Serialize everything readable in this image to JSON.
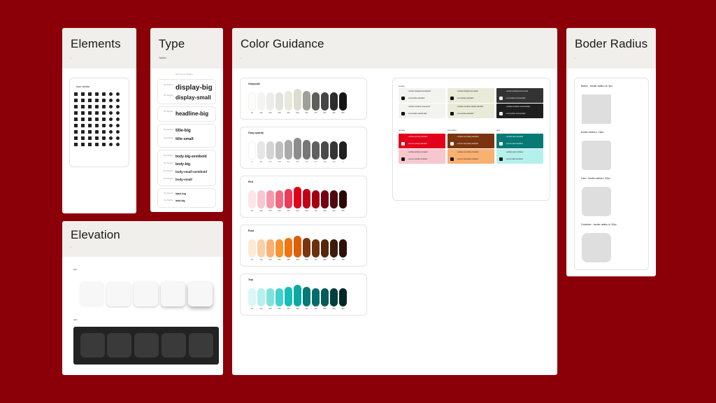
{
  "elements": {
    "title": "Elements",
    "sub": "-",
    "icon_panel_label": "icon stroke"
  },
  "type": {
    "title": "Type",
    "sub": "Tablet",
    "header_note": "Size  Line Ht  Tracking",
    "rows": [
      {
        "meta": "Tiny Medium",
        "text": "display-big"
      },
      {
        "meta": "Tiny Medium",
        "text": "display-small"
      },
      {
        "meta": "Tiny Medium",
        "text": "headline-big"
      },
      {
        "meta": "Tiny Medium",
        "text": "title-big"
      },
      {
        "meta": "Tiny Medium",
        "text": "title-small"
      },
      {
        "meta": "Tiny Medium",
        "text": "body-big-semibold"
      },
      {
        "meta": "Tiny Medium",
        "text": "body-big"
      },
      {
        "meta": "Tiny Medium",
        "text": "body-small-semibold"
      },
      {
        "meta": "Tiny Medium",
        "text": "body-small"
      },
      {
        "meta": "Tiny Medium",
        "text": "label-big"
      },
      {
        "meta": "Tiny Medium",
        "text": "label-big"
      }
    ]
  },
  "color": {
    "title": "Color Guidance",
    "sub": "-",
    "scales": [
      {
        "name": "Grayscale",
        "colors": [
          "#fbfbf8",
          "#f4f4f1",
          "#ececea",
          "#e2e2de",
          "#e8e8dc",
          "#dcdccf",
          "#a0a098",
          "#5e5e5c",
          "#454545",
          "#2d2d2d",
          "#151515"
        ],
        "labels": [
          "50",
          "100",
          "200",
          "300",
          "400",
          "500",
          "600",
          "700",
          "800",
          "900",
          "950"
        ]
      },
      {
        "name": "Gray-opacity",
        "colors": [
          "#ffffff",
          "#e6e6e6",
          "#d4d4d4",
          "#bfbfbf",
          "#aaaaaa",
          "#8c8c8c",
          "#777777",
          "#606060",
          "#4a4a4a",
          "#353535",
          "#202020"
        ],
        "labels": [
          "0",
          "0.1",
          "0.2",
          "0.3",
          "0.4",
          "0.5",
          "0.6",
          "0.7",
          "0.8",
          "0.9",
          "1"
        ]
      },
      {
        "name": "Red",
        "colors": [
          "#fbe6e8",
          "#f7c7cf",
          "#f59aab",
          "#f2667f",
          "#ec3a58",
          "#e3001b",
          "#c10017",
          "#a30014",
          "#760012",
          "#4e0b0d",
          "#2c0607"
        ],
        "labels": [
          "50",
          "100",
          "200",
          "300",
          "400",
          "500",
          "600",
          "700",
          "800",
          "900",
          "950"
        ]
      },
      {
        "name": "Rust",
        "colors": [
          "#fde9d6",
          "#fbd0a8",
          "#f9b070",
          "#f7932f",
          "#f07410",
          "#dd5f07",
          "#7a3510",
          "#6b300f",
          "#57270c",
          "#3c1c0c",
          "#2a1208"
        ],
        "labels": [
          "50",
          "100",
          "200",
          "300",
          "400",
          "500",
          "600",
          "700",
          "800",
          "900",
          "950"
        ]
      },
      {
        "name": "Teal",
        "colors": [
          "#dcf7f5",
          "#b4f0ec",
          "#7fe3dd",
          "#3fd3cc",
          "#14bfb8",
          "#0ea8a2",
          "#087a75",
          "#066e6a",
          "#055b58",
          "#043e3d",
          "#022928"
        ],
        "labels": [
          "50",
          "100",
          "200",
          "300",
          "400",
          "500",
          "600",
          "700",
          "800",
          "900",
          "950"
        ]
      }
    ],
    "surfaces": {
      "group_surface": "surface",
      "group_primary": "primary",
      "group_secondary": "secondary",
      "group_alert": "alert",
      "tiles": [
        {
          "bg": "#f3f3f0",
          "fg": "#222",
          "dot": "#111",
          "a": "--surface-background-standard",
          "b": "--text-surface-standard"
        },
        {
          "bg": "#e9ead8",
          "fg": "#222",
          "dot": "#111",
          "a": "--surface-background-variant",
          "b": "--text-surface-standard"
        },
        {
          "bg": "#333333",
          "fg": "#eee",
          "dot": "#eee",
          "a": "--surface-background-inverted",
          "b": "--text-surface-inverted-light"
        },
        {
          "bg": "#f3f3f0",
          "fg": "#222",
          "dot": "#111",
          "a": "--surface-container-lowest-low",
          "b": "--text-surface-variant-high"
        },
        {
          "bg": "#e9ead8",
          "fg": "#222",
          "dot": "#111",
          "a": "--surface-container-variant-standard",
          "b": "--text-surface-standard"
        },
        {
          "bg": "#1f1f1f",
          "fg": "#eee",
          "dot": "#eee",
          "a": "--surface-container-inverted-high",
          "b": "--text-surface-inverted-light"
        },
        {
          "bg": "#e3001b",
          "fg": "#fff",
          "dot": "#fff",
          "a": "--surface-primary-standard",
          "b": "--text-on-primary-standard"
        },
        {
          "bg": "#7a3510",
          "fg": "#fff",
          "dot": "#fff",
          "a": "--surface-secondary-standard",
          "b": "--text-on-secondary-standard"
        },
        {
          "bg": "#087a75",
          "fg": "#fff",
          "dot": "#fff",
          "a": "--surface-alert-standard",
          "b": "--text-on-alert-standard"
        },
        {
          "bg": "#f7c7cf",
          "fg": "#222",
          "dot": "#111",
          "a": "--surface-primary-container",
          "b": "--text-on-primary-container"
        },
        {
          "bg": "#f9b070",
          "fg": "#222",
          "dot": "#111",
          "a": "--surface-secondary-container",
          "b": "--text-on-secondary-container"
        },
        {
          "bg": "#b4f0ec",
          "fg": "#222",
          "dot": "#111",
          "a": "--surface-alert-container",
          "b": "--text-on-alert-container"
        }
      ]
    }
  },
  "radius": {
    "title": "Boder Radius",
    "sub": "-",
    "items": [
      {
        "label": "Button - border-radius-xs: 4px",
        "r": 4
      },
      {
        "label": "border-radius-s: 16px",
        "r": 6
      },
      {
        "label": "Card - border-radius-l: 32px",
        "r": 8
      },
      {
        "label": "Container - border-radius-xl: 32px",
        "r": 10
      }
    ]
  },
  "elevation": {
    "title": "Elevation",
    "sub": "-",
    "light_label": "light",
    "dark_label": "dark"
  }
}
